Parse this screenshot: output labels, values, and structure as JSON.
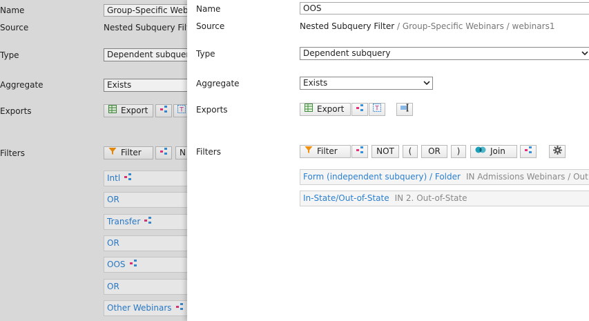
{
  "back_panel": {
    "labels": {
      "name": "Name",
      "source": "Source",
      "type": "Type",
      "aggregate": "Aggregate",
      "exports": "Exports",
      "filters": "Filters"
    },
    "name_value": "Group-Specific Webinar",
    "source_value": "Nested Subquery Filter",
    "type_value": "Dependent subquery",
    "aggregate_value": "Exists",
    "export_button": "Export",
    "filter_button": "Filter",
    "next_button_partial": "N",
    "filter_rows": [
      {
        "text": "Intl",
        "node": true
      },
      {
        "text": "OR",
        "node": false
      },
      {
        "text": "Transfer",
        "node": true
      },
      {
        "text": "OR",
        "node": false
      },
      {
        "text": "OOS",
        "node": true
      },
      {
        "text": "OR",
        "node": false
      },
      {
        "text": "Other Webinars",
        "node": true
      }
    ]
  },
  "front_panel": {
    "labels": {
      "name": "Name",
      "source": "Source",
      "type": "Type",
      "aggregate": "Aggregate",
      "exports": "Exports",
      "filters": "Filters"
    },
    "name_value": "OOS",
    "source": {
      "main": "Nested Subquery Filter",
      "path": " / Group-Specific Webinars / webinars1"
    },
    "type_value": "Dependent subquery",
    "aggregate_value": "Exists",
    "export_button": "Export",
    "filter_toolbar": {
      "filter": "Filter",
      "not": "NOT",
      "open_paren": "(",
      "or": "OR",
      "close_paren": ")",
      "join": "Join"
    },
    "filter_rows": [
      {
        "link": "Form (independent subquery) / Folder",
        "detail": "IN Admissions Webinars / Out of St..."
      },
      {
        "link": "In-State/Out-of-State",
        "detail": "IN 2. Out-of-State"
      }
    ]
  },
  "colors": {
    "link": "#2a7fd0",
    "filter_funnel": "#f0900c",
    "node_pink": "#e2337a",
    "node_blue": "#3b8fd6",
    "join_teal": "#1aa0b8"
  }
}
